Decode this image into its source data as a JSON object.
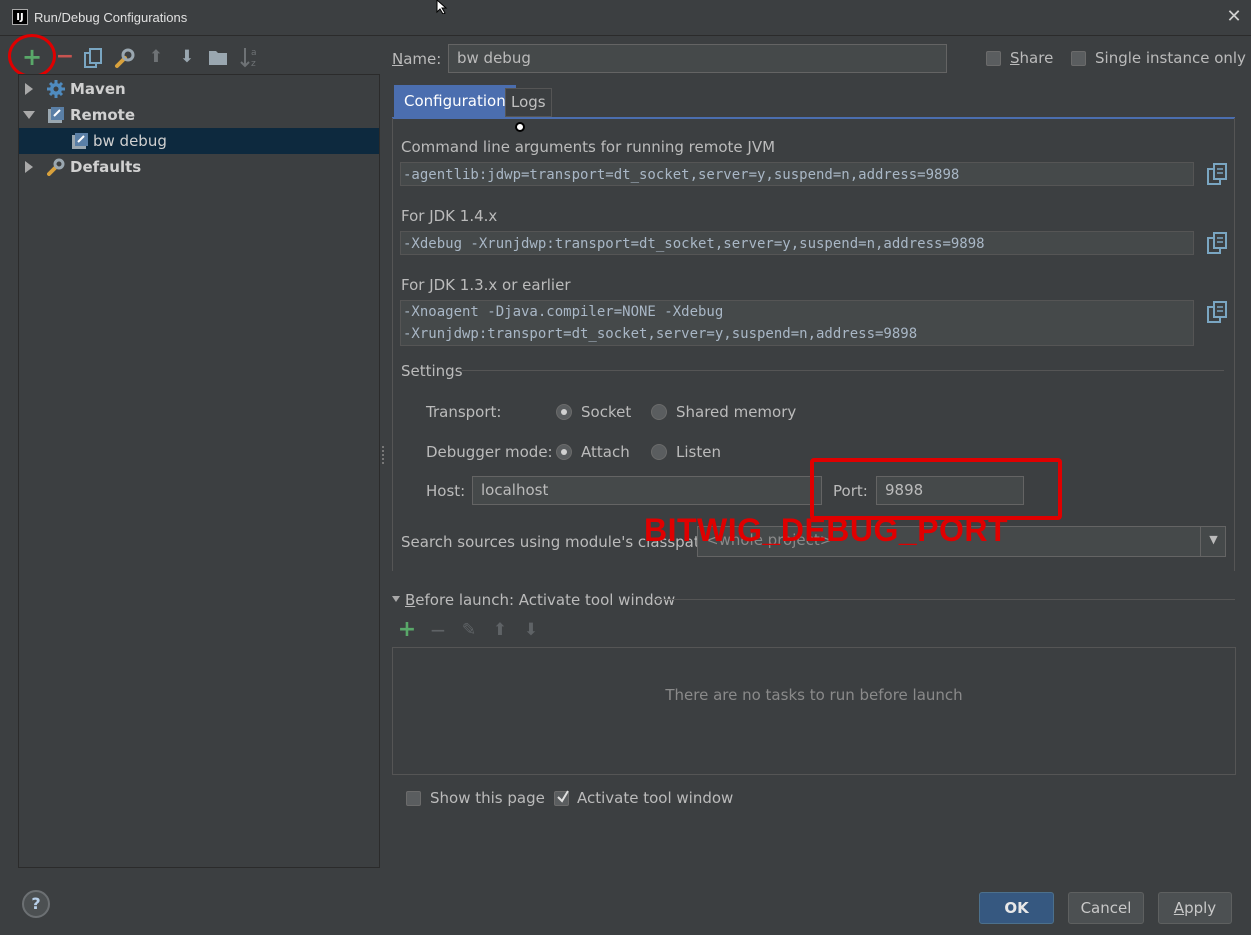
{
  "window": {
    "title": "Run/Debug Configurations",
    "app_icon_glyph": "IJ",
    "close_glyph": "✕"
  },
  "toolbar": {
    "add_glyph": "+",
    "remove_glyph": "−",
    "up_glyph": "⬆",
    "down_glyph": "⬇"
  },
  "tree": {
    "items": [
      {
        "label": "Maven",
        "icon": "gear-icon"
      },
      {
        "label": "Remote",
        "icon": "remote-icon"
      },
      {
        "label": "bw debug",
        "icon": "remote-config-icon"
      },
      {
        "label": "Defaults",
        "icon": "wrench-icon"
      }
    ]
  },
  "name_row": {
    "label": "Name:",
    "value": "bw debug",
    "share_label": "Share",
    "single_instance_label": "Single instance only"
  },
  "tabs": [
    {
      "label": "Configuration"
    },
    {
      "label": "Logs"
    }
  ],
  "config": {
    "cmd_label": "Command line arguments for running remote JVM",
    "cmd_value": "-agentlib:jdwp=transport=dt_socket,server=y,suspend=n,address=9898",
    "jdk14_label": "For JDK 1.4.x",
    "jdk14_value": "-Xdebug -Xrunjdwp:transport=dt_socket,server=y,suspend=n,address=9898",
    "jdk13_label": "For JDK 1.3.x or earlier",
    "jdk13_line1": "-Xnoagent -Djava.compiler=NONE -Xdebug",
    "jdk13_line2": "-Xrunjdwp:transport=dt_socket,server=y,suspend=n,address=9898",
    "settings_label": "Settings",
    "transport_label": "Transport:",
    "socket_label": "Socket",
    "shared_memory_label": "Shared memory",
    "debugger_mode_label": "Debugger mode:",
    "attach_label": "Attach",
    "listen_label": "Listen",
    "host_label": "Host:",
    "host_value": "localhost",
    "port_label": "Port:",
    "port_value": "9898",
    "classpath_label": "Search sources using module's classpath:",
    "classpath_value": "<whole project>"
  },
  "before_launch": {
    "title": "Before launch: Activate tool window",
    "empty_text": "There are no tasks to run before launch",
    "add_glyph": "+",
    "remove_glyph": "−",
    "edit_glyph": "✎",
    "up_glyph": "⬆",
    "down_glyph": "⬇"
  },
  "footer": {
    "show_page_label": "Show this page",
    "activate_label": "Activate tool window",
    "ok_label": "OK",
    "cancel_label": "Cancel",
    "apply_label": "Apply",
    "help_glyph": "?"
  },
  "annotation": {
    "text": "BITWIG_DEBUG_PORT",
    "color": "#e00000"
  },
  "colors": {
    "background": "#3c3f41",
    "selection": "#0d293e",
    "accent_tab": "#4b6eaf",
    "add_green": "#59a869"
  }
}
